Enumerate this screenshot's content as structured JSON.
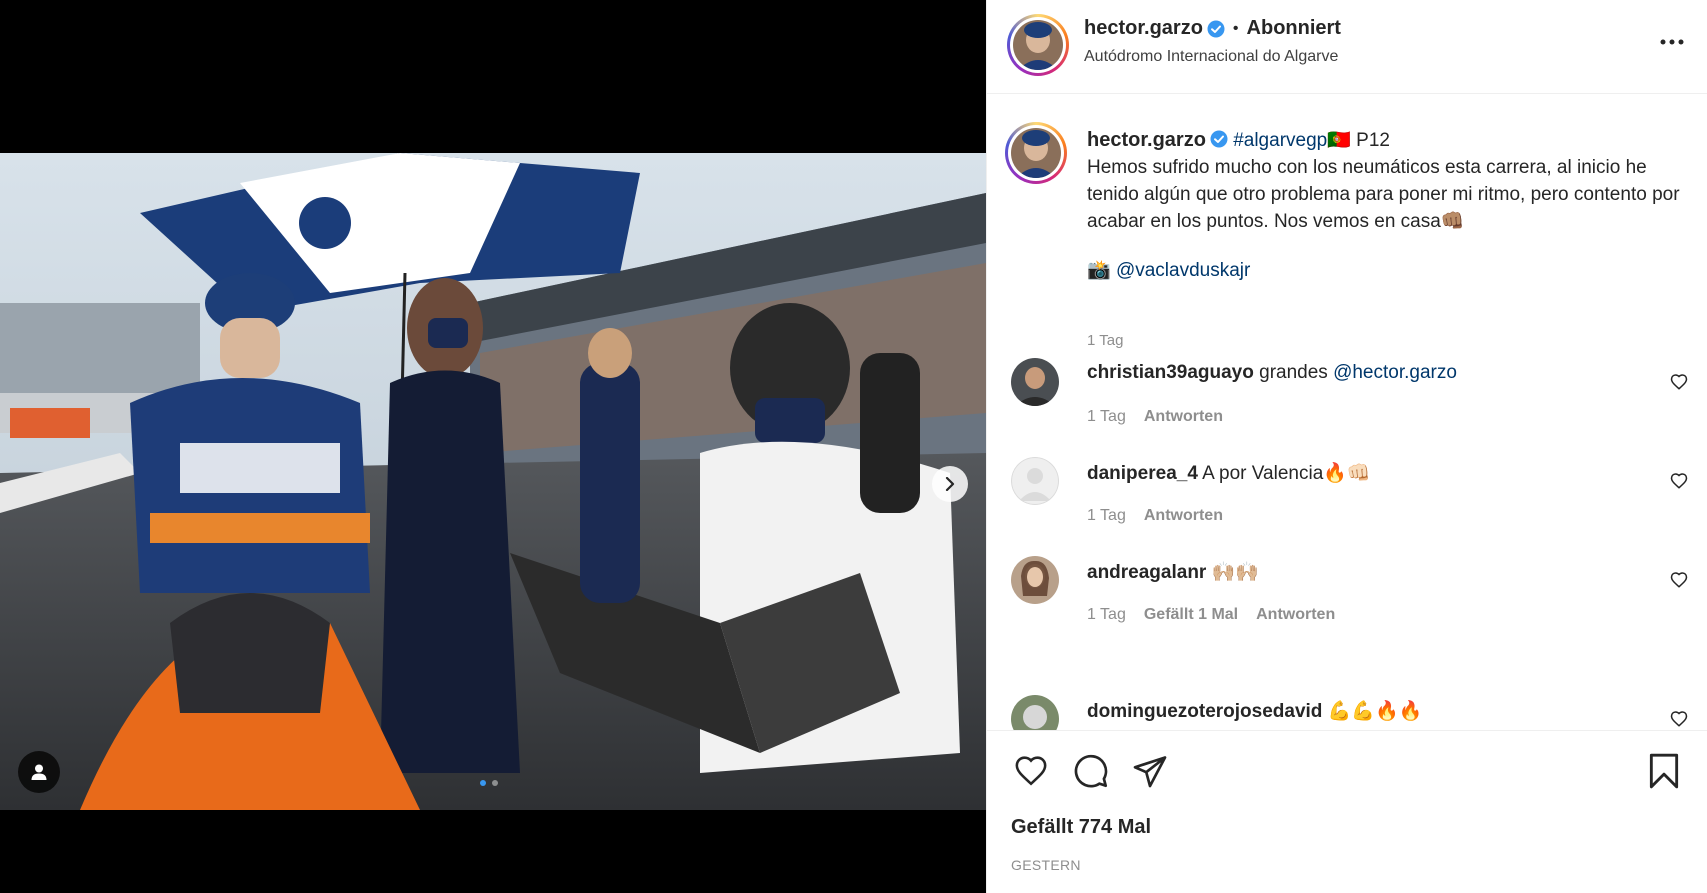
{
  "post": {
    "author": "hector.garzo",
    "follow_status": "Abonniert",
    "separator": "•",
    "location": "Autódromo Internacional do Algarve",
    "media": {
      "slide_index": 1,
      "slide_count": 2
    }
  },
  "caption": {
    "author": "hector.garzo",
    "hashtag": "#algarvegp",
    "flag": "🇵🇹",
    "body_after_tag": " P12",
    "text": "Hemos sufrido mucho con los neumáticos esta carrera, al inicio he tenido algún que otro problema para poner mi ritmo, pero contento por acabar en los puntos. Nos vemos en casa👊🏽",
    "credit_icon": "📸",
    "credit_mention": "@vaclavduskajr",
    "time": "1 Tag"
  },
  "comments": [
    {
      "user": "christian39aguayo",
      "text": "grandes ",
      "mention": "@hector.garzo",
      "time": "1 Tag",
      "likes_label": "",
      "reply_label": "Antworten",
      "avatar": "photo-avatar"
    },
    {
      "user": "daniperea_4",
      "text": "A por Valencia🔥👊🏻",
      "mention": "",
      "time": "1 Tag",
      "likes_label": "",
      "reply_label": "Antworten",
      "avatar": "default-avatar"
    },
    {
      "user": "andreagalanr",
      "text": "🙌🏼🙌🏼",
      "mention": "",
      "time": "1 Tag",
      "likes_label": "Gefällt 1 Mal",
      "reply_label": "Antworten",
      "avatar": "photo-avatar"
    },
    {
      "user": "dominguezoterojosedavid",
      "text": "💪💪🔥🔥",
      "mention": "",
      "time": "",
      "likes_label": "",
      "reply_label": "",
      "avatar": "photo-avatar"
    }
  ],
  "footer": {
    "likes_text": "Gefällt 774 Mal",
    "date": "GESTERN"
  },
  "icons": {
    "like": "heart-icon",
    "comment": "comment-icon",
    "share": "share-icon",
    "save": "bookmark-icon",
    "more": "more-options-icon",
    "next": "chevron-right-icon",
    "tag": "user-tag-icon",
    "verified": "verified-badge-icon"
  },
  "colors": {
    "verified_blue": "#3897f0",
    "link": "#00376b",
    "muted": "#8e8e8e",
    "text": "#262626"
  }
}
